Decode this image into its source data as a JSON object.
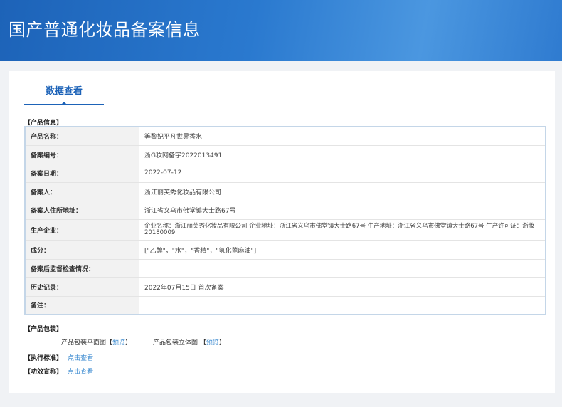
{
  "header": {
    "title": "国产普通化妆品备案信息"
  },
  "tabs": [
    {
      "label": "数据查看"
    }
  ],
  "product_info": {
    "section_title": "【产品信息】",
    "rows": [
      {
        "label": "产品名称：",
        "value": "等黎妃平凡世界香水"
      },
      {
        "label": "备案编号：",
        "value": "浙G妆网备字2022013491"
      },
      {
        "label": "备案日期：",
        "value": "2022-07-12"
      },
      {
        "label": "备案人：",
        "value": "浙江丽芙秀化妆品有限公司"
      },
      {
        "label": "备案人住所地址：",
        "value": "浙江省义乌市佛堂镇大士路67号"
      },
      {
        "label": "生产企业：",
        "value": "企业名称：浙江丽芙秀化妆品有限公司 企业地址：浙江省义乌市佛堂镇大士路67号 生产地址：浙江省义乌市佛堂镇大士路67号 生产许可证：浙妆 20180009"
      },
      {
        "label": "成分：",
        "value": "[\"乙醇\"，\"水\"，\"香精\"，\"氢化蓖麻油\"]"
      },
      {
        "label": "备案后监督检查情况：",
        "value": ""
      },
      {
        "label": "历史记录：",
        "value": "2022年07月15日 首次备案"
      },
      {
        "label": "备注：",
        "value": ""
      }
    ]
  },
  "packaging": {
    "section_title": "【产品包装】",
    "flat_label": "产品包装平面图",
    "solid_label": "产品包装立体图",
    "preview": "预览",
    "bracket_open": "【",
    "bracket_close": "】"
  },
  "standard": {
    "label": "【执行标准】",
    "link": "点击查看"
  },
  "efficacy": {
    "label": "【功效宣称】",
    "link": "点击查看"
  }
}
